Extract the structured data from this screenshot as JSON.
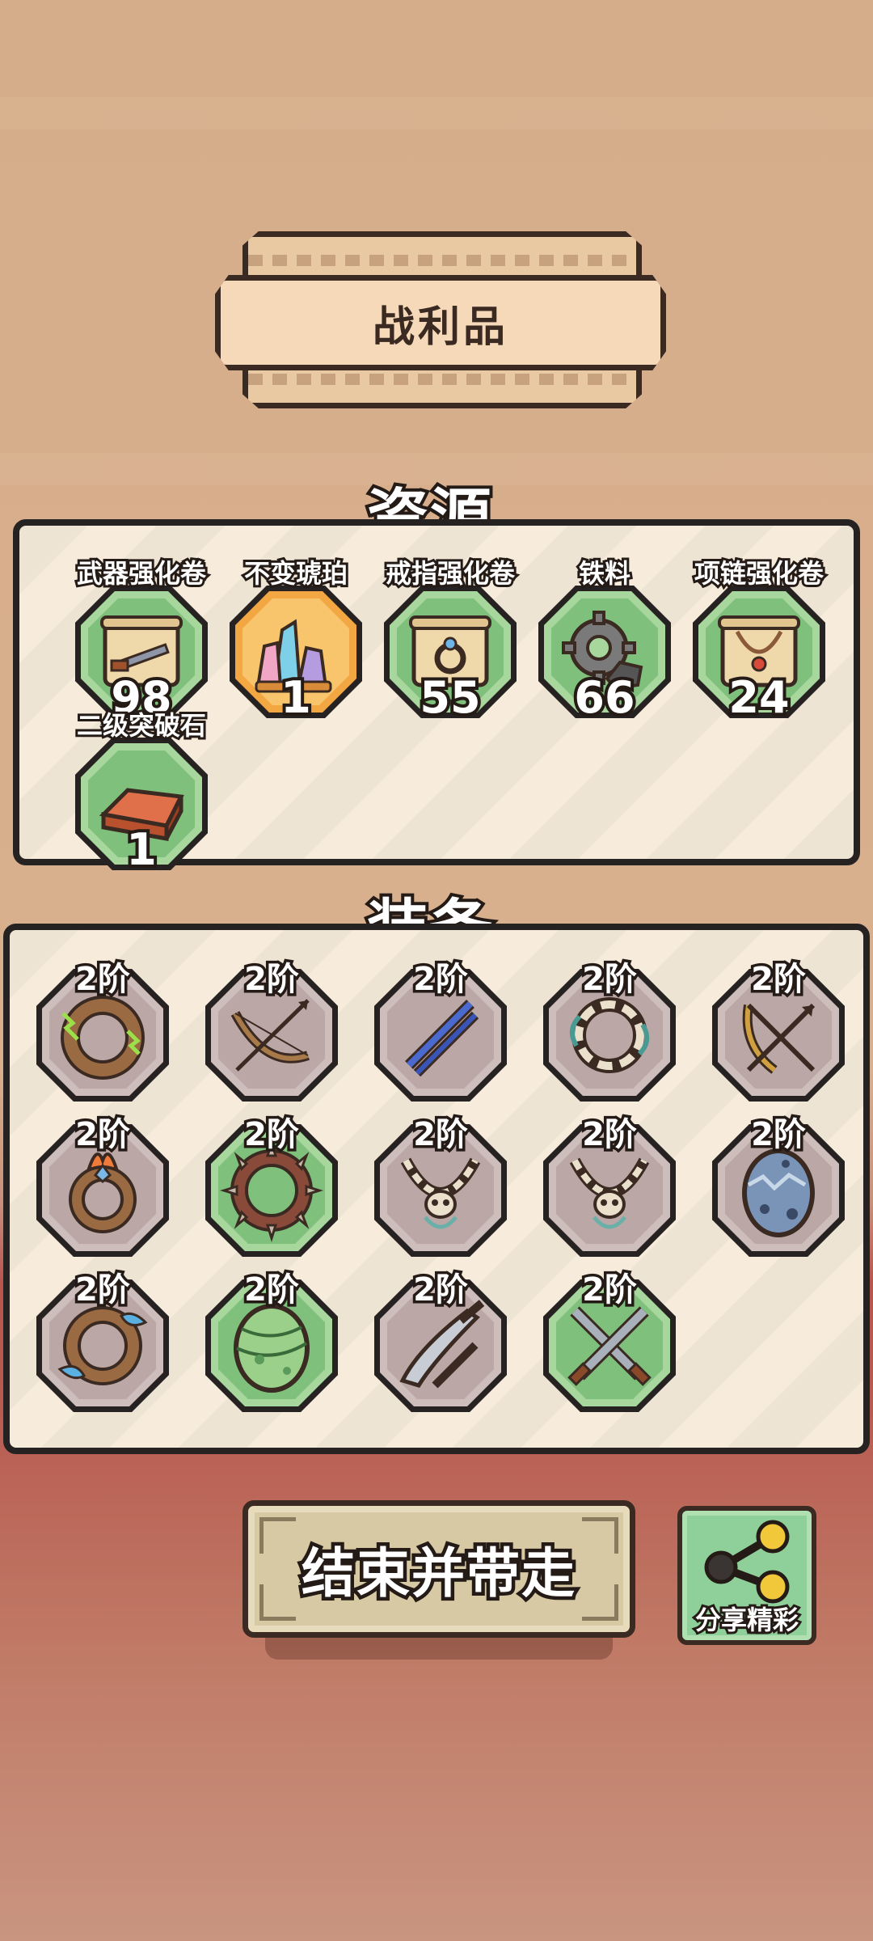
{
  "title": "战利品",
  "resources": {
    "heading": "资源",
    "items": [
      {
        "name": "武器强化卷",
        "count": "98",
        "icon": "scroll-sword-icon",
        "rarity": "green"
      },
      {
        "name": "不变琥珀",
        "count": "1",
        "icon": "crystal-icon",
        "rarity": "gold"
      },
      {
        "name": "戒指强化卷",
        "count": "55",
        "icon": "scroll-ring-icon",
        "rarity": "green"
      },
      {
        "name": "铁料",
        "count": "66",
        "icon": "gear-ore-icon",
        "rarity": "green"
      },
      {
        "name": "项链强化卷",
        "count": "24",
        "icon": "scroll-necklace-icon",
        "rarity": "green"
      },
      {
        "name": "二级突破石",
        "count": "1",
        "icon": "ingot-icon",
        "rarity": "green"
      }
    ]
  },
  "equipment": {
    "heading": "装备",
    "items": [
      {
        "tier": "2阶",
        "icon": "lightning-ring-icon",
        "rarity": "gray"
      },
      {
        "tier": "2阶",
        "icon": "bow-icon",
        "rarity": "gray"
      },
      {
        "tier": "2阶",
        "icon": "katana-icon",
        "rarity": "gray"
      },
      {
        "tier": "2阶",
        "icon": "bone-necklace-icon",
        "rarity": "gray"
      },
      {
        "tier": "2阶",
        "icon": "crossbow-icon",
        "rarity": "gray"
      },
      {
        "tier": "2阶",
        "icon": "fire-ring-icon",
        "rarity": "gray"
      },
      {
        "tier": "2阶",
        "icon": "spiked-ring-icon",
        "rarity": "green"
      },
      {
        "tier": "2阶",
        "icon": "skull-necklace-icon",
        "rarity": "gray"
      },
      {
        "tier": "2阶",
        "icon": "skull-necklace-icon",
        "rarity": "gray"
      },
      {
        "tier": "2阶",
        "icon": "blue-egg-icon",
        "rarity": "gray"
      },
      {
        "tier": "2阶",
        "icon": "water-ring-icon",
        "rarity": "gray"
      },
      {
        "tier": "2阶",
        "icon": "green-egg-icon",
        "rarity": "green"
      },
      {
        "tier": "2阶",
        "icon": "machete-icon",
        "rarity": "gray"
      },
      {
        "tier": "2阶",
        "icon": "twin-swords-icon",
        "rarity": "green"
      }
    ]
  },
  "buttons": {
    "end": "结束并带走",
    "share": "分享精彩"
  }
}
